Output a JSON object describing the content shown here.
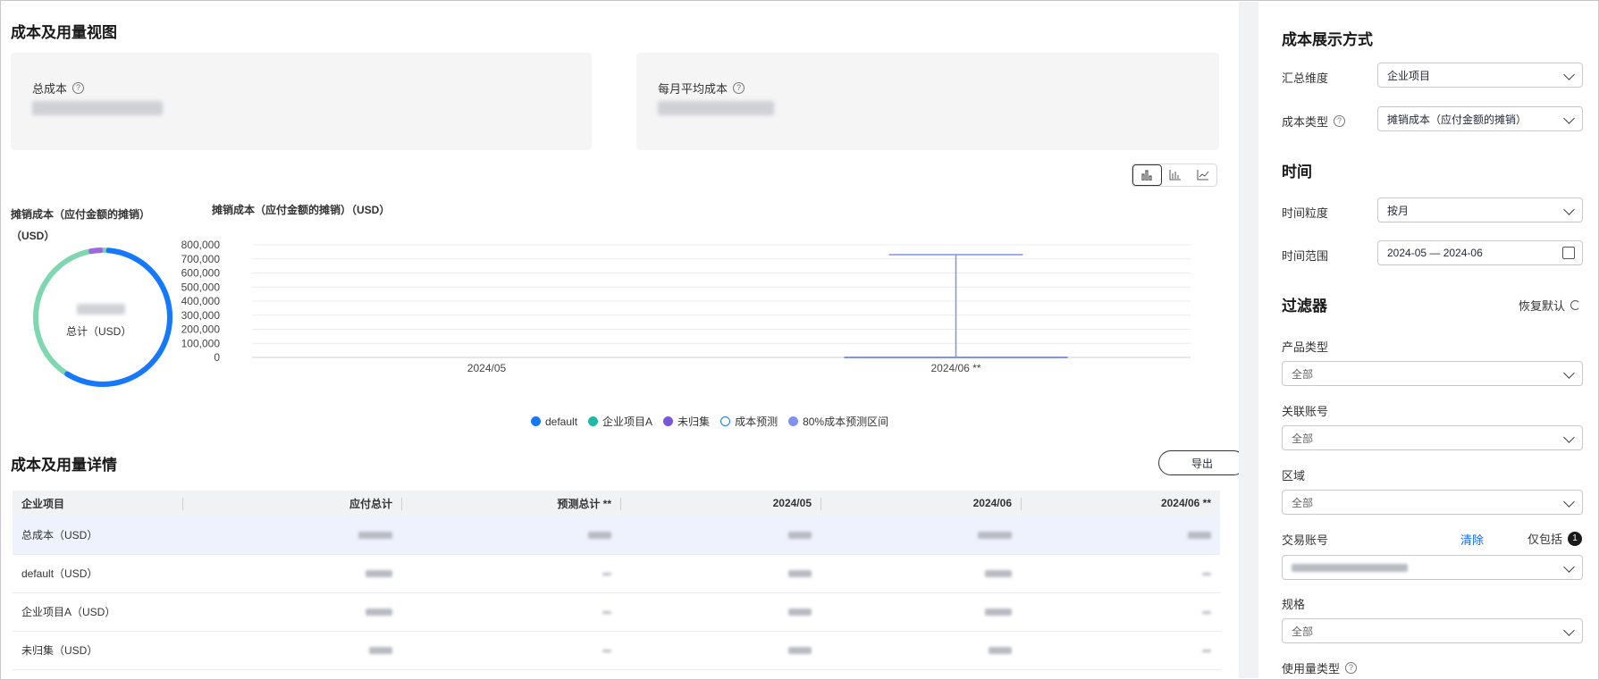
{
  "main": {
    "title": "成本及用量视图",
    "cards": [
      {
        "label": "总成本"
      },
      {
        "label": "每月平均成本"
      }
    ],
    "view_toggle": [
      "bar-chart-icon",
      "column-chart-icon",
      "line-chart-icon"
    ],
    "donut": {
      "title": "摊销成本（应付金额的摊销）（USD）",
      "center_label": "总计（USD）",
      "colors": {
        "default": "#1677ff",
        "project_a": "#7fd7b2",
        "unassigned": "#9b6ae0"
      }
    },
    "chart_title": "摊销成本（应付金额的摊销）（USD）",
    "chart_data": {
      "type": "bar",
      "categories": [
        "2024/05",
        "2024/06 **"
      ],
      "yticks": [
        "800,000",
        "700,000",
        "600,000",
        "500,000",
        "400,000",
        "300,000",
        "200,000",
        "100,000",
        "0"
      ],
      "ylim": [
        0,
        800000
      ],
      "forecast_interval": {
        "category": "2024/06 **",
        "low": 0,
        "high": 730000
      },
      "legend": [
        "default",
        "企业项目A",
        "未归集",
        "成本预测",
        "80%成本预测区间"
      ],
      "legend_colors": [
        "#1677ff",
        "#1fb9a5",
        "#7a57d8",
        "#ffffff",
        "#7d93ef"
      ]
    },
    "details_title": "成本及用量详情",
    "export_label": "导出",
    "table": {
      "headers": [
        "企业项目",
        "应付总计",
        "预测总计 **",
        "2024/05",
        "2024/06",
        "2024/06 **"
      ],
      "rows": [
        {
          "name": "总成本（USD）"
        },
        {
          "name": "default（USD）"
        },
        {
          "name": "企业项目A（USD）"
        },
        {
          "name": "未归集（USD）"
        }
      ]
    }
  },
  "side": {
    "display_title": "成本展示方式",
    "summary_label": "汇总维度",
    "summary_value": "企业项目",
    "cost_type_label": "成本类型",
    "cost_type_value": "摊销成本（应付金额的摊销）",
    "time_title": "时间",
    "granularity_label": "时间粒度",
    "granularity_value": "按月",
    "range_label": "时间范围",
    "range_value": "2024-05 — 2024-06",
    "filter_title": "过滤器",
    "reset_label": "恢复默认",
    "product_label": "产品类型",
    "product_value": "全部",
    "linked_label": "关联账号",
    "linked_value": "全部",
    "region_label": "区域",
    "region_value": "全部",
    "txn_label": "交易账号",
    "clear_label": "清除",
    "only_label": "仅包括",
    "only_count": "1",
    "spec_label": "规格",
    "spec_value": "全部",
    "usage_label": "使用量类型"
  }
}
